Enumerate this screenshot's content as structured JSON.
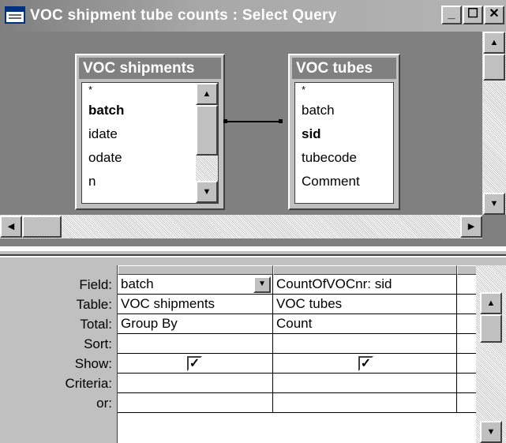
{
  "window": {
    "title": "VOC shipment tube counts : Select Query",
    "minimize_glyph": "_",
    "maximize_glyph": "☐",
    "close_glyph": "✕"
  },
  "tables": [
    {
      "name": "VOC shipments",
      "fields": [
        {
          "label": "*",
          "bold": false
        },
        {
          "label": "batch",
          "bold": true
        },
        {
          "label": "idate",
          "bold": false
        },
        {
          "label": "odate",
          "bold": false
        },
        {
          "label": "n",
          "bold": false
        }
      ]
    },
    {
      "name": "VOC tubes",
      "fields": [
        {
          "label": "*",
          "bold": false
        },
        {
          "label": "batch",
          "bold": false
        },
        {
          "label": "sid",
          "bold": true
        },
        {
          "label": "tubecode",
          "bold": false
        },
        {
          "label": "Comment",
          "bold": false
        }
      ]
    }
  ],
  "grid": {
    "row_labels": [
      "Field:",
      "Table:",
      "Total:",
      "Sort:",
      "Show:",
      "Criteria:",
      "or:"
    ],
    "columns": [
      {
        "field": "batch",
        "table": "VOC shipments",
        "total": "Group By",
        "sort": "",
        "show": true,
        "criteria": "",
        "or": ""
      },
      {
        "field": "CountOfVOCnr: sid",
        "table": "VOC tubes",
        "total": "Count",
        "sort": "",
        "show": true,
        "criteria": "",
        "or": ""
      }
    ],
    "check_glyph": "✓"
  },
  "icons": {
    "up": "▲",
    "down": "▼",
    "left": "◀",
    "right": "▶"
  }
}
